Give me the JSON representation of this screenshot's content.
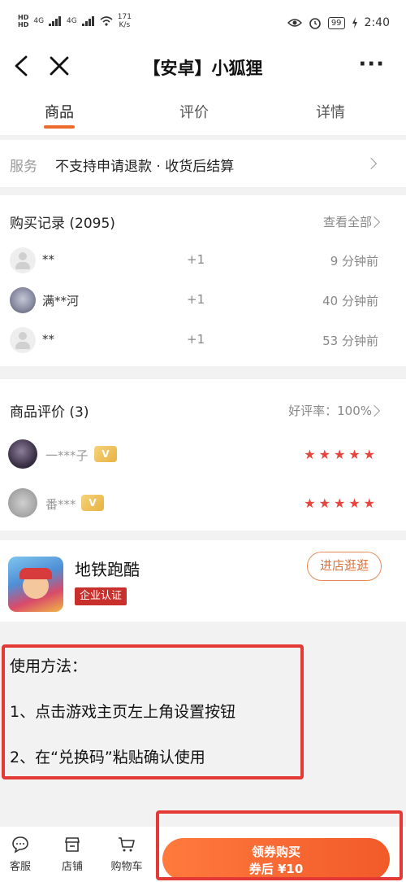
{
  "status_bar": {
    "hd": "HD",
    "signal1": "4G",
    "signal2": "4G",
    "net_speed_value": "171",
    "net_speed_unit": "K/s",
    "battery": "99",
    "time": "2:40"
  },
  "nav": {
    "title": "【安卓】小狐狸",
    "more": "···"
  },
  "tabs": [
    {
      "label": "商品",
      "active": true
    },
    {
      "label": "评价",
      "active": false
    },
    {
      "label": "详情",
      "active": false
    }
  ],
  "service": {
    "label": "服务",
    "text": "不支持申请退款 · 收货后结算"
  },
  "purchase_records": {
    "title": "购买记录 (2095)",
    "view_all": "查看全部",
    "records": [
      {
        "name": "**",
        "qty": "+1",
        "time": "9 分钟前",
        "avatar": "default"
      },
      {
        "name": "满**河",
        "qty": "+1",
        "time": "40 分钟前",
        "avatar": "photo"
      },
      {
        "name": "**",
        "qty": "+1",
        "time": "53 分钟前",
        "avatar": "default"
      }
    ]
  },
  "reviews": {
    "title": "商品评价 (3)",
    "rating": "好评率：100%",
    "items": [
      {
        "name": "一***子",
        "stars": "★★★★★",
        "rating": 5
      },
      {
        "name": "番***",
        "stars": "★★★★★",
        "rating": 5
      }
    ]
  },
  "store": {
    "name": "地铁跑酷",
    "badge": "企业认证",
    "visit_label": "进店逛逛"
  },
  "usage": {
    "lines": [
      "使用方法：",
      "1、点击游戏主页左上角设置按钮",
      "2、在“兑换码”粘贴确认使用"
    ]
  },
  "bottom_bar": {
    "service_label": "客服",
    "store_label": "店铺",
    "cart_label": "购物车",
    "buy_line1": "领券购买",
    "buy_line2": "券后 ¥10"
  },
  "colors": {
    "accent": "#ec6a2c",
    "star": "#e8453c",
    "highlight_box": "#e53935"
  }
}
